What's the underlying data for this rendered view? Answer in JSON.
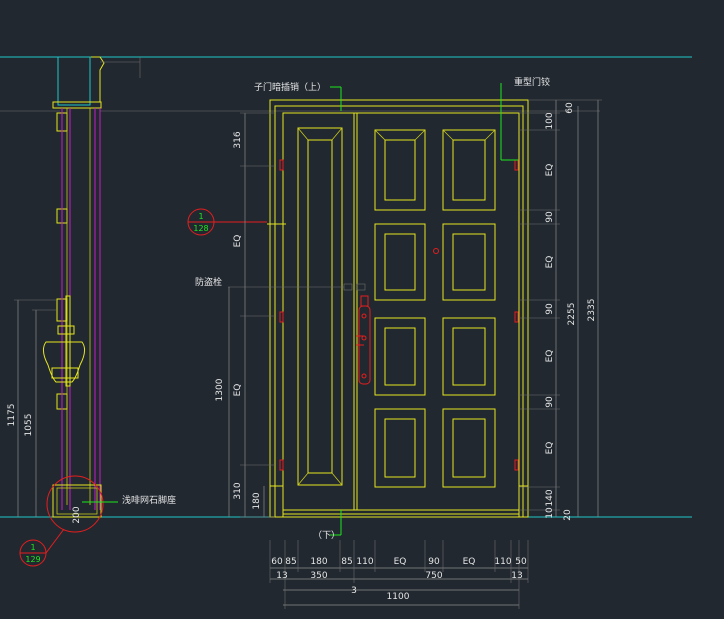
{
  "labels": {
    "sub_door_bolt_top": "子门暗插销（上）",
    "sub_door_bolt_bottom": "（下）",
    "hinge": "重型门铰",
    "peephole": "防盗栓",
    "stone_base": "浅啡网石脚座"
  },
  "callouts": [
    {
      "top": "1",
      "bottom": "128"
    },
    {
      "top": "1",
      "bottom": "129"
    }
  ],
  "dims": {
    "right": [
      "60",
      "100",
      "EQ",
      "90",
      "EQ",
      "90",
      "EQ",
      "90",
      "EQ",
      "140",
      "20",
      "10"
    ],
    "total_inner": "2255",
    "total_outer": "2335",
    "left_door": [
      "316",
      "EQ",
      "1300",
      "310",
      "180"
    ],
    "left_side": [
      "1175",
      "1055",
      "200"
    ],
    "bottom_row1": [
      "60",
      "85",
      "180",
      "85",
      "110",
      "EQ",
      "90",
      "EQ",
      "110",
      "50"
    ],
    "bottom_row2": [
      "13",
      "350",
      "750",
      "13"
    ],
    "bottom_row3": [
      "3"
    ],
    "bottom_total": "1100"
  }
}
